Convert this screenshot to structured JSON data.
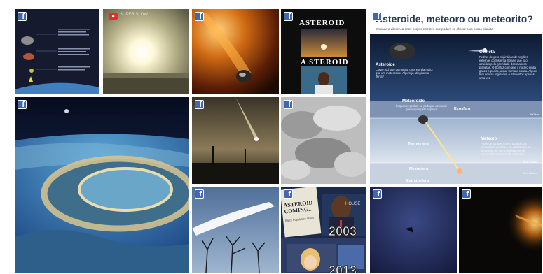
{
  "tiles": {
    "t1": {
      "alt": "asteroid comparison diagram"
    },
    "t2": {
      "video_label": "SUPER SLOW"
    },
    "t5": {
      "top_text": "ASTEROID",
      "bottom_text": "A STEROID"
    },
    "t14": {
      "sign_title": "ASTEROID COMING...",
      "sign_sub": "Black Population Study",
      "year1": "2003",
      "year2": "2013",
      "tv_text": "HOUSE"
    }
  },
  "infographic": {
    "title": "Asteroide, meteoro ou meteorito?",
    "subtitle": "Entenda a diferença entre corpos celestes que podem se chocar com nosso planeta",
    "asteroid_heading": "Asteroide",
    "asteroid_text": "Corpo rochoso que orbita uma estrela maior que um meteoroide. Algum já atingiram a Terra?",
    "comet_heading": "Cometa",
    "comet_text": "Pedras de gelo originárias de regiões externas do Sistema Solar e que são atraídas pela gravidade dos maiores planetas. O Sol faz com que o núcleo emita gases e poeira, o que forma a cauda. Alguns têm órbitas regulares, e são vistos apenas uma vez",
    "meteoroid_heading": "Meteoroide",
    "meteoroid_text": "Pequenas pedras ou pedaços de metal que viajam pelo espaço",
    "exosphere": "Exosfera",
    "exosphere_km": "500 km",
    "thermosphere": "Termosfera",
    "meteor_heading": "Meteoro",
    "meteor_text": "Flash de luz que ocorre quando um meteoroide queima e se desintegra na atmosfera da Terra (popularmente conhecido como estrela cadente)",
    "thermo_km": "80 a 90 km",
    "mesosphere": "Mesosfera",
    "meso_km": "50 a 80 km",
    "stratosphere": "Estratosfera"
  },
  "colors": {
    "facebook": "#4267b2",
    "youtube": "#e52d27"
  }
}
